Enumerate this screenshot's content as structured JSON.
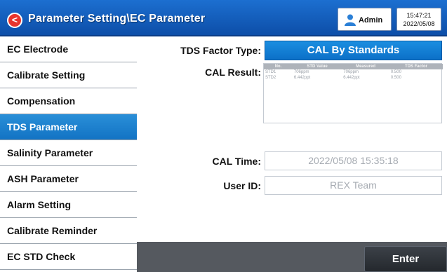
{
  "header": {
    "back_symbol": "<",
    "title": "Parameter Setting\\EC Parameter",
    "user": "Admin",
    "time": "15:47:21",
    "date": "2022/05/08",
    "colors": {
      "bar": "#1565c8",
      "back_button": "#e8342c"
    }
  },
  "sidebar": {
    "items": [
      {
        "label": "EC Electrode"
      },
      {
        "label": "Calibrate Setting"
      },
      {
        "label": "Compensation"
      },
      {
        "label": "TDS Parameter",
        "active": true
      },
      {
        "label": "Salinity Parameter"
      },
      {
        "label": "ASH Parameter"
      },
      {
        "label": "Alarm Setting"
      },
      {
        "label": "Calibrate Reminder"
      },
      {
        "label": "EC STD Check"
      }
    ],
    "active_color": "#1a80d0"
  },
  "main": {
    "factor_type_label": "TDS Factor Type:",
    "factor_type_value": "CAL By Standards",
    "cal_result_label": "CAL Result:",
    "cal_result_table": {
      "headers": [
        "No.",
        "STD Value",
        "Measured",
        "TDS Factor"
      ],
      "rows": [
        [
          "STD1",
          "706ppm",
          "706ppm",
          "0.500"
        ],
        [
          "STD2",
          "6.442ppt",
          "6.442ppt",
          "0.500"
        ]
      ]
    },
    "cal_time_label": "CAL Time:",
    "cal_time_value": "2022/05/08  15:35:18",
    "user_id_label": "User ID:",
    "user_id_value": "REX Team"
  },
  "footer": {
    "enter_label": "Enter"
  },
  "icons": {
    "back": "back-arrow-icon",
    "user": "user-icon"
  }
}
